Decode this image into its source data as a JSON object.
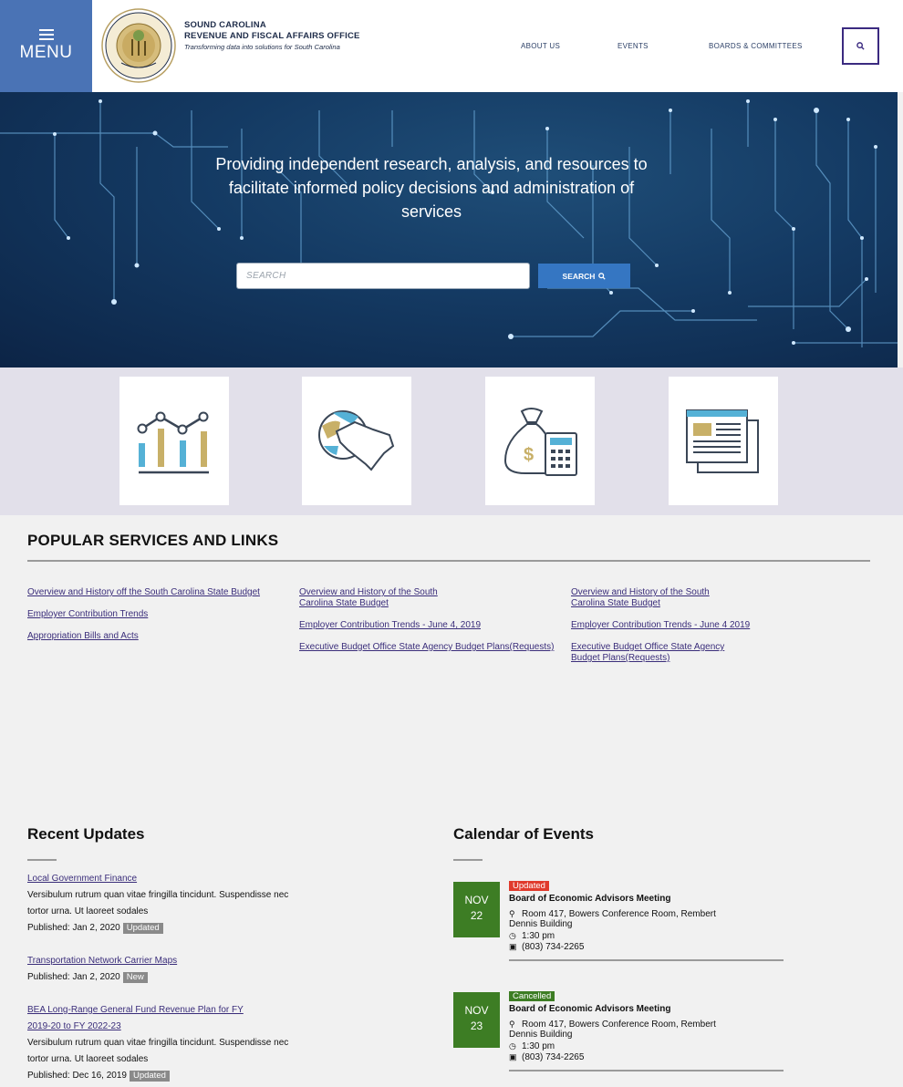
{
  "header": {
    "menu_label": "MENU",
    "org_line1": "SOUND CAROLINA",
    "org_line2": "REVENUE AND FISCAL AFFAIRS OFFICE",
    "org_line3": "Transforming data into solutions for South Carolina",
    "nav": [
      "ABOUT US",
      "EVENTS",
      "BOARDS & COMMITTEES"
    ]
  },
  "hero": {
    "tagline": "Providing independent research, analysis, and resources to facilitate informed policy decisions and administration of services",
    "search_placeholder": "SEARCH",
    "search_button": "SEARCH"
  },
  "tiles": [
    "chart-icon",
    "globe-state-icon",
    "money-calculator-icon",
    "newspaper-icon"
  ],
  "popular": {
    "title": "POPULAR SERVICES AND LINKS",
    "col1": [
      "Overview and History off the South Carolina State Budget",
      "Employer Contribution Trends",
      "Appropriation Bills and Acts"
    ],
    "col2": [
      "Overview and History of the South Carolina State Budget",
      "Employer Contribution Trends - June 4, 2019",
      "Executive Budget Office State Agency Budget Plans(Requests)"
    ],
    "col3": [
      "Overview and History of the South Carolina State Budget",
      "Employer Contribution Trends - June 4 2019",
      "Executive Budget Office State Agency Budget Plans(Requests)"
    ]
  },
  "updates": {
    "title": "Recent Updates",
    "items": [
      {
        "link": "Local Government Finance",
        "desc1": "Versibulum rutrum quan vitae fringilla tincidunt. Suspendisse nec",
        "desc2": "tortor urna. Ut laoreet sodales",
        "published": "Published: Jan 2, 2020",
        "badge": "Updated"
      },
      {
        "link": "Transportation Network Carrier Maps",
        "published": "Published: Jan 2, 2020",
        "badge": "New"
      },
      {
        "link1": "BEA Long-Range General Fund Revenue Plan for FY",
        "link2": "2019-20 to FY 2022-23",
        "desc1": "Versibulum rutrum quan vitae fringilla tincidunt. Suspendisse nec",
        "desc2": "tortor urna. Ut laoreet sodales",
        "published": "Published: Dec 16, 2019",
        "badge": "Updated"
      }
    ]
  },
  "calendar": {
    "title": "Calendar of Events",
    "events": [
      {
        "month": "NOV",
        "day": "22",
        "status": "Updated",
        "status_color": "#e03a2c",
        "title": "Board of Economic Advisors Meeting",
        "location1": "Room 417, Bowers Conference Room, Rembert",
        "location2": "Dennis Building",
        "time": "1:30 pm",
        "phone": "(803) 734-2265"
      },
      {
        "month": "NOV",
        "day": "23",
        "status": "Cancelled",
        "status_color": "#3d7d24",
        "title": "Board of Economic Advisors Meeting",
        "location1": "Room 417, Bowers Conference Room, Rembert",
        "location2": "Dennis Building",
        "time": "1:30 pm",
        "phone": "(803) 734-2265"
      }
    ]
  },
  "colors": {
    "menu_bg": "#4a73b5",
    "hero_bg": "#143a63",
    "search_btn": "#3576c2",
    "link": "#3a2d7a",
    "date_bg": "#3d7d24"
  }
}
